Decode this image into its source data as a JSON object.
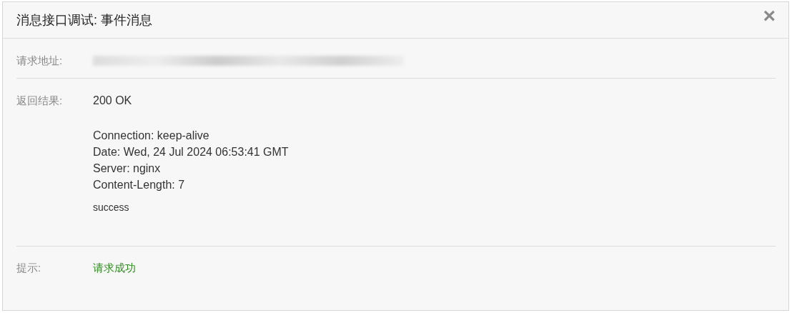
{
  "dialog": {
    "title": "消息接口调试: 事件消息",
    "close": "×"
  },
  "request": {
    "label": "请求地址:"
  },
  "result": {
    "label": "返回结果:",
    "status": "200 OK",
    "headers": [
      "Connection: keep-alive",
      "Date: Wed, 24 Jul 2024 06:53:41 GMT",
      "Server: nginx",
      "Content-Length: 7"
    ],
    "body": "success"
  },
  "hint": {
    "label": "提示:",
    "message": "请求成功",
    "ok": true
  }
}
